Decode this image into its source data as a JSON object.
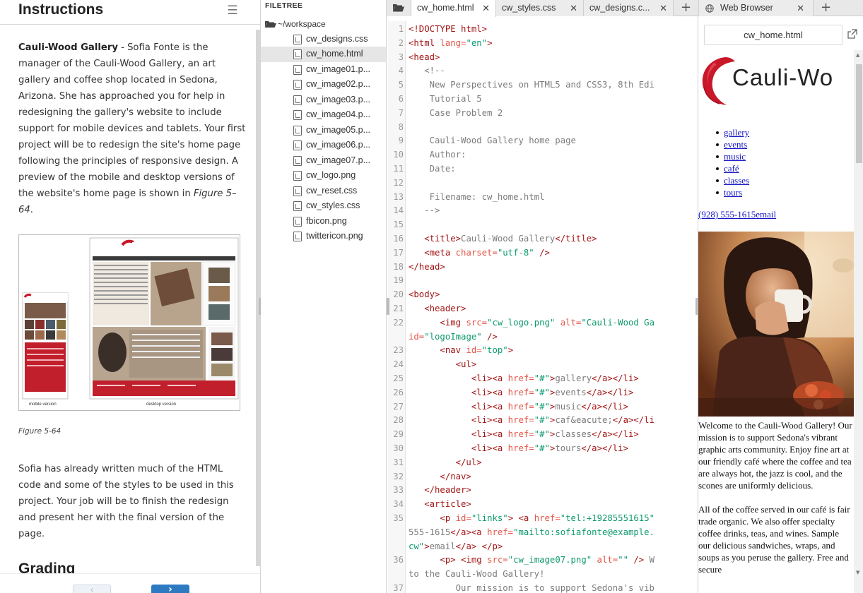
{
  "instructions": {
    "title": "Instructions",
    "para1_lead": "Cauli-Wood Gallery",
    "para1_text": " - Sofia Fonte is the manager of the Cauli-Wood Gallery, an art gallery and coffee shop located in Sedona, Arizona. She has approached you for help in redesigning the gallery's website to include support for mobile devices and tablets. Your first project will be to redesign the site's home page following the principles of responsive design. A preview of the mobile and desktop versions of the website's home page is shown in ",
    "para1_ref": "Figure 5–64",
    "para1_end": ".",
    "figure_mobile_label": "mobile version",
    "figure_desktop_label": "desktop version",
    "figure_caption": "Figure 5-64",
    "para2": "Sofia has already written much of the HTML code and some of the styles to be used in this project. Your job will be to finish the redesign and present her with the final version of the page.",
    "grading_heading": "Grading",
    "prev_glyph": "‹",
    "next_glyph": "›"
  },
  "filetree": {
    "title": "FILETREE",
    "root": "~/workspace",
    "files": [
      {
        "name": "cw_designs.css",
        "selected": false
      },
      {
        "name": "cw_home.html",
        "selected": true
      },
      {
        "name": "cw_image01.p...",
        "selected": false
      },
      {
        "name": "cw_image02.p...",
        "selected": false
      },
      {
        "name": "cw_image03.p...",
        "selected": false
      },
      {
        "name": "cw_image04.p...",
        "selected": false
      },
      {
        "name": "cw_image05.p...",
        "selected": false
      },
      {
        "name": "cw_image06.p...",
        "selected": false
      },
      {
        "name": "cw_image07.p...",
        "selected": false
      },
      {
        "name": "cw_logo.png",
        "selected": false
      },
      {
        "name": "cw_reset.css",
        "selected": false
      },
      {
        "name": "cw_styles.css",
        "selected": false
      },
      {
        "name": "fbicon.png",
        "selected": false
      },
      {
        "name": "twittericon.png",
        "selected": false
      }
    ]
  },
  "tabs": [
    {
      "label": "cw_home.html",
      "close": "✕",
      "active": true
    },
    {
      "label": "cw_styles.css",
      "close": "✕",
      "active": false
    },
    {
      "label": "cw_designs.c...",
      "close": "✕",
      "active": false
    }
  ],
  "add_tab_glyph": "+",
  "browser_tab": {
    "label": "Web Browser",
    "close": "✕"
  },
  "editor": {
    "lines": [
      {
        "n": "1",
        "segs": [
          [
            "tg",
            "<!DOCTYPE html>"
          ]
        ]
      },
      {
        "n": "2",
        "segs": [
          [
            "tg",
            "<html "
          ],
          [
            "at",
            "lang="
          ],
          [
            "vl",
            "\"en\""
          ],
          [
            "tg",
            ">"
          ]
        ]
      },
      {
        "n": "3",
        "segs": [
          [
            "tg",
            "<head>"
          ]
        ]
      },
      {
        "n": "4",
        "segs": [
          [
            "cm",
            "   <!--"
          ]
        ]
      },
      {
        "n": "5",
        "segs": [
          [
            "cm",
            "    New Perspectives on HTML5 and CSS3, 8th Edi"
          ]
        ]
      },
      {
        "n": "6",
        "segs": [
          [
            "cm",
            "    Tutorial 5"
          ]
        ]
      },
      {
        "n": "7",
        "segs": [
          [
            "cm",
            "    Case Problem 2"
          ]
        ]
      },
      {
        "n": "8",
        "segs": [
          [
            "cm",
            ""
          ]
        ]
      },
      {
        "n": "9",
        "segs": [
          [
            "cm",
            "    Cauli-Wood Gallery home page"
          ]
        ]
      },
      {
        "n": "10",
        "segs": [
          [
            "cm",
            "    Author:"
          ]
        ]
      },
      {
        "n": "11",
        "segs": [
          [
            "cm",
            "    Date:"
          ]
        ]
      },
      {
        "n": "12",
        "segs": [
          [
            "cm",
            ""
          ]
        ]
      },
      {
        "n": "13",
        "segs": [
          [
            "cm",
            "    Filename: cw_home.html"
          ]
        ]
      },
      {
        "n": "14",
        "segs": [
          [
            "cm",
            "   -->"
          ]
        ]
      },
      {
        "n": "15",
        "segs": [
          [
            "cm",
            ""
          ]
        ]
      },
      {
        "n": "16",
        "segs": [
          [
            "tg",
            "   <title>"
          ],
          [
            "cm",
            "Cauli-Wood Gallery"
          ],
          [
            "tg",
            "</title>"
          ]
        ]
      },
      {
        "n": "17",
        "segs": [
          [
            "tg",
            "   <meta "
          ],
          [
            "at",
            "charset="
          ],
          [
            "vl",
            "\"utf-8\""
          ],
          [
            "tg",
            " />"
          ]
        ]
      },
      {
        "n": "18",
        "segs": [
          [
            "tg",
            "</head>"
          ]
        ]
      },
      {
        "n": "19",
        "segs": [
          [
            "cm",
            ""
          ]
        ]
      },
      {
        "n": "20",
        "segs": [
          [
            "tg",
            "<body>"
          ]
        ]
      },
      {
        "n": "21",
        "segs": [
          [
            "tg",
            "   <header>"
          ]
        ]
      },
      {
        "n": "22",
        "segs": [
          [
            "tg",
            "      <img "
          ],
          [
            "at",
            "src="
          ],
          [
            "vl",
            "\"cw_logo.png\""
          ],
          [
            "at",
            " alt="
          ],
          [
            "vl",
            "\"Cauli-Wood Ga"
          ]
        ]
      },
      {
        "n": "",
        "segs": [
          [
            "at",
            "id="
          ],
          [
            "vl",
            "\"logoImage\""
          ],
          [
            "tg",
            " />"
          ]
        ]
      },
      {
        "n": "23",
        "segs": [
          [
            "tg",
            "      <nav "
          ],
          [
            "at",
            "id="
          ],
          [
            "vl",
            "\"top\""
          ],
          [
            "tg",
            ">"
          ]
        ]
      },
      {
        "n": "24",
        "segs": [
          [
            "tg",
            "         <ul>"
          ]
        ]
      },
      {
        "n": "25",
        "segs": [
          [
            "tg",
            "            <li><a "
          ],
          [
            "at",
            "href="
          ],
          [
            "vl",
            "\"#\""
          ],
          [
            "tg",
            ">"
          ],
          [
            "cm",
            "gallery"
          ],
          [
            "tg",
            "</a></li>"
          ]
        ]
      },
      {
        "n": "26",
        "segs": [
          [
            "tg",
            "            <li><a "
          ],
          [
            "at",
            "href="
          ],
          [
            "vl",
            "\"#\""
          ],
          [
            "tg",
            ">"
          ],
          [
            "cm",
            "events"
          ],
          [
            "tg",
            "</a></li>"
          ]
        ]
      },
      {
        "n": "27",
        "segs": [
          [
            "tg",
            "            <li><a "
          ],
          [
            "at",
            "href="
          ],
          [
            "vl",
            "\"#\""
          ],
          [
            "tg",
            ">"
          ],
          [
            "cm",
            "music"
          ],
          [
            "tg",
            "</a></li>"
          ]
        ]
      },
      {
        "n": "28",
        "segs": [
          [
            "tg",
            "            <li><a "
          ],
          [
            "at",
            "href="
          ],
          [
            "vl",
            "\"#\""
          ],
          [
            "tg",
            ">"
          ],
          [
            "cm",
            "caf&eacute;"
          ],
          [
            "tg",
            "</a></li"
          ]
        ]
      },
      {
        "n": "29",
        "segs": [
          [
            "tg",
            "            <li><a "
          ],
          [
            "at",
            "href="
          ],
          [
            "vl",
            "\"#\""
          ],
          [
            "tg",
            ">"
          ],
          [
            "cm",
            "classes"
          ],
          [
            "tg",
            "</a></li>"
          ]
        ]
      },
      {
        "n": "30",
        "segs": [
          [
            "tg",
            "            <li><a "
          ],
          [
            "at",
            "href="
          ],
          [
            "vl",
            "\"#\""
          ],
          [
            "tg",
            ">"
          ],
          [
            "cm",
            "tours"
          ],
          [
            "tg",
            "</a></li>"
          ]
        ]
      },
      {
        "n": "31",
        "segs": [
          [
            "tg",
            "         </ul>"
          ]
        ]
      },
      {
        "n": "32",
        "segs": [
          [
            "tg",
            "      </nav>"
          ]
        ]
      },
      {
        "n": "33",
        "segs": [
          [
            "tg",
            "   </header>"
          ]
        ]
      },
      {
        "n": "34",
        "segs": [
          [
            "tg",
            "   <article>"
          ]
        ]
      },
      {
        "n": "35",
        "segs": [
          [
            "tg",
            "      <p "
          ],
          [
            "at",
            "id="
          ],
          [
            "vl",
            "\"links\""
          ],
          [
            "tg",
            "> <a "
          ],
          [
            "at",
            "href="
          ],
          [
            "vl",
            "\"tel:+19285551615\""
          ]
        ]
      },
      {
        "n": "",
        "segs": [
          [
            "cm",
            "555-1615"
          ],
          [
            "tg",
            "</a><a "
          ],
          [
            "at",
            "href="
          ],
          [
            "vl",
            "\"mailto:sofiafonte@example."
          ]
        ]
      },
      {
        "n": "",
        "segs": [
          [
            "vl",
            "cw\""
          ],
          [
            "tg",
            ">"
          ],
          [
            "cm",
            "email"
          ],
          [
            "tg",
            "</a> </p>"
          ]
        ]
      },
      {
        "n": "36",
        "segs": [
          [
            "tg",
            "      <p> <img "
          ],
          [
            "at",
            "src="
          ],
          [
            "vl",
            "\"cw_image07.png\""
          ],
          [
            "at",
            " alt="
          ],
          [
            "vl",
            "\"\""
          ],
          [
            "tg",
            " />"
          ],
          [
            "cm",
            " W"
          ]
        ]
      },
      {
        "n": "",
        "segs": [
          [
            "cm",
            "to the Cauli-Wood Gallery!"
          ]
        ]
      },
      {
        "n": "37",
        "segs": [
          [
            "cm",
            "         Our mission is to support Sedona's vib"
          ]
        ]
      }
    ]
  },
  "browser": {
    "url": "cw_home.html",
    "logo_text": "Cauli-Wo",
    "nav": [
      "gallery",
      "events",
      "music",
      "café",
      "classes",
      "tours"
    ],
    "phone": "(928) 555-1615",
    "email": "email",
    "welcome_p1": "Welcome to the Cauli-Wood Gallery! Our mission is to support Sedona's vibrant graphic arts community. Enjoy fine art at our friendly café where the coffee and tea are always hot, the jazz is cool, and the scones are uniformly delicious.",
    "welcome_p2": "All of the coffee served in our café is fair trade organic. We also offer specialty coffee drinks, teas, and wines. Sample our delicious sandwiches, wraps, and soups as you peruse the gallery. Free and secure"
  },
  "colors": {
    "tag": "#a31515",
    "attr": "#e45649",
    "value": "#0e9a6e",
    "comment": "#7c7c7c",
    "link": "#1515c4",
    "next_button": "#2d7ac3",
    "logo_red": "#c8182a"
  }
}
